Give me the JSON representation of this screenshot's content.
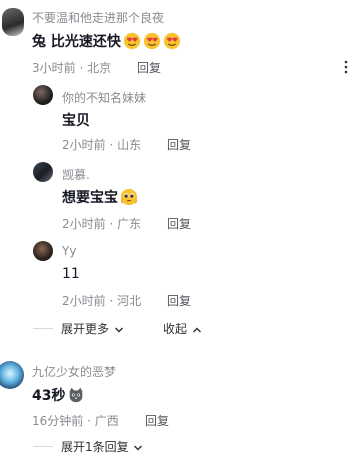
{
  "top_comment": {
    "username": "不要温和他走进那个良夜",
    "text": "兔 比光速还快",
    "emojis": [
      "heart-eyes-emoji",
      "heart-eyes-emoji",
      "heart-eyes-emoji"
    ],
    "meta": "3小时前 · 北京",
    "reply_label": "回复"
  },
  "replies": [
    {
      "username": "你的不知名妹妹",
      "text": "宝贝",
      "meta": "2小时前 · 山东",
      "reply_label": "回复"
    },
    {
      "username": "觊慕.",
      "text": "想要宝宝",
      "emoji": "pleading-face-emoji",
      "meta": "2小时前 · 广东",
      "reply_label": "回复"
    },
    {
      "username": "Yy",
      "text": "11",
      "meta": "2小时前 · 河北",
      "reply_label": "回复"
    }
  ],
  "thread_controls": {
    "expand_label": "展开更多",
    "collapse_label": "收起"
  },
  "second_comment": {
    "username": "九亿少女的恶梦",
    "text": "43秒",
    "emoji": "cat-emoji",
    "meta": "16分钟前 · 广西",
    "reply_label": "回复",
    "expand_label": "展开1条回复"
  }
}
